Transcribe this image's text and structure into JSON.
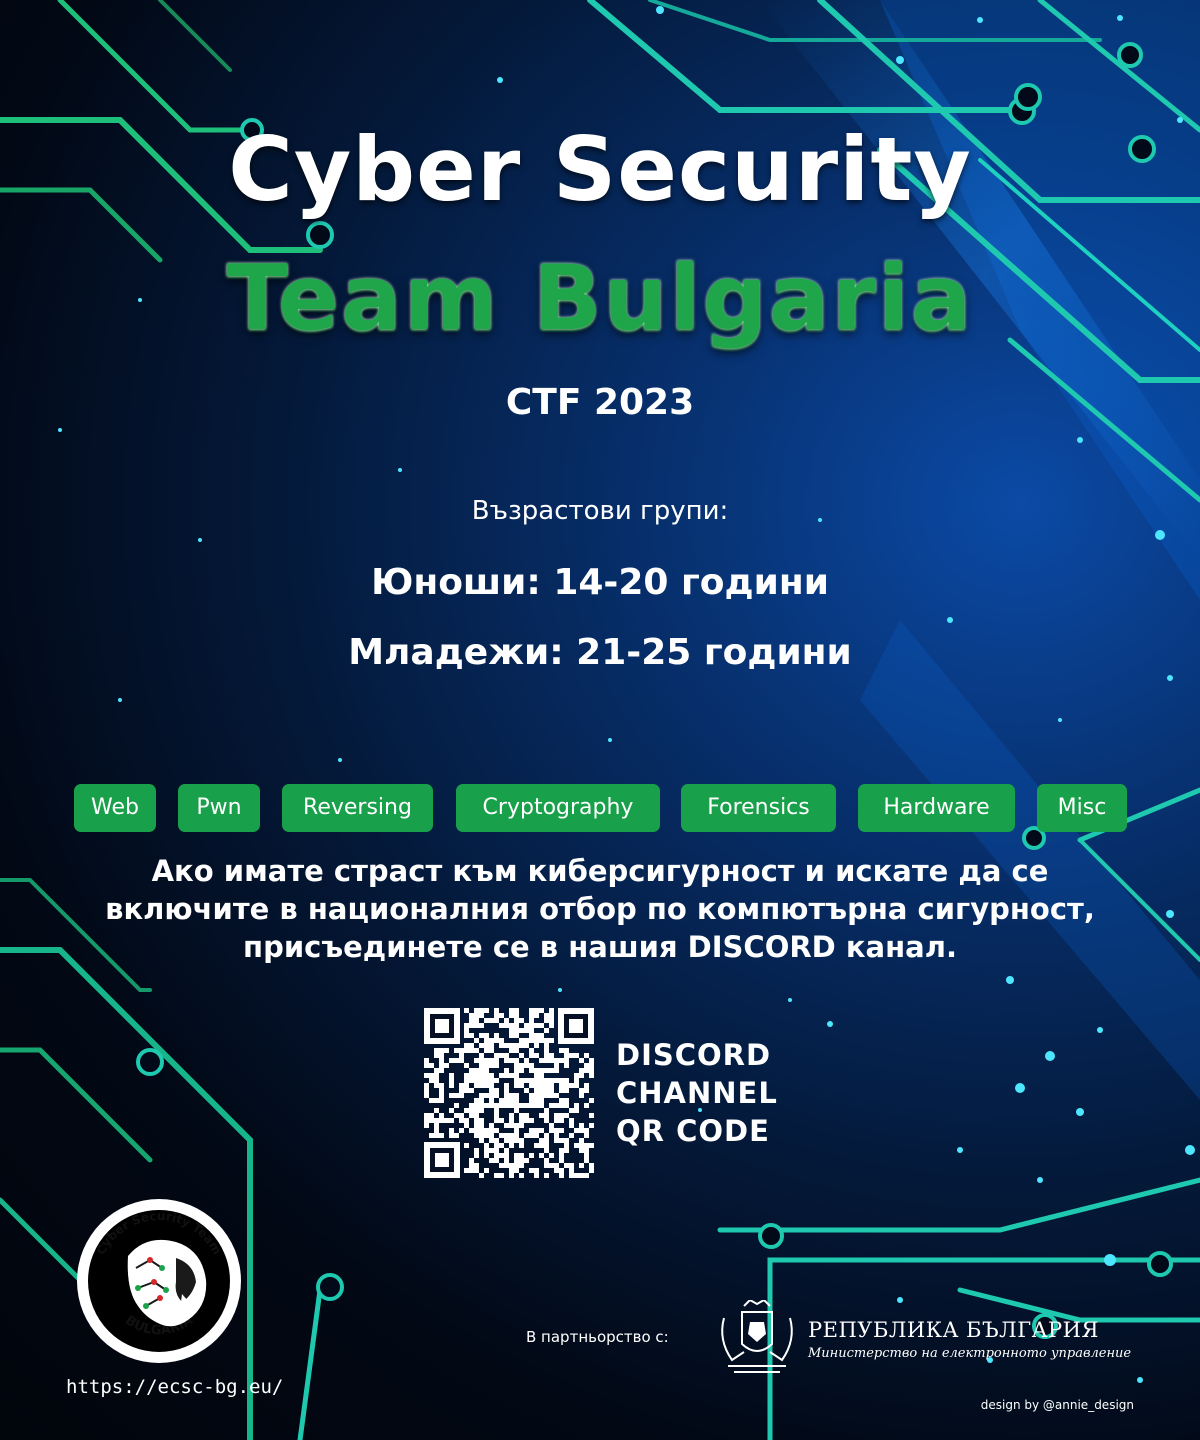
{
  "header": {
    "title_line1": "Cyber Security",
    "title_line2": "Team Bulgaria",
    "subtitle": "CTF 2023"
  },
  "groups": {
    "label": "Възрастови групи:",
    "juniors": "Юноши: 14-20 години",
    "youth": "Младежи: 21-25 години"
  },
  "categories": [
    "Web",
    "Pwn",
    "Reversing",
    "Cryptography",
    "Forensics",
    "Hardware",
    "Misc"
  ],
  "promo": {
    "line1": "Ако имате страст към киберсигурност и искате да се",
    "line2": "включите в националния отбор по компютърна сигурност,",
    "line3": "присъединете се в нашия DISCORD канал."
  },
  "qr": {
    "line1": "DISCORD",
    "line2": "CHANNEL",
    "line3": "QR CODE"
  },
  "logo": {
    "top_text": "Cyber Security Team",
    "bottom_text": "BULGARIA"
  },
  "footer": {
    "url": "https://ecsc-bg.eu/",
    "partner_label": "В партньорство с:",
    "ministry_title": "РЕПУБЛИКА БЪЛГАРИЯ",
    "ministry_subtitle": "Министерство на електронното управление",
    "credit": "design by @annie_design"
  },
  "colors": {
    "accent_green": "#18a14a",
    "circuit_teal": "#1ec9b0",
    "background_blue": "#0b4aa6",
    "background_dark": "#01050c"
  }
}
